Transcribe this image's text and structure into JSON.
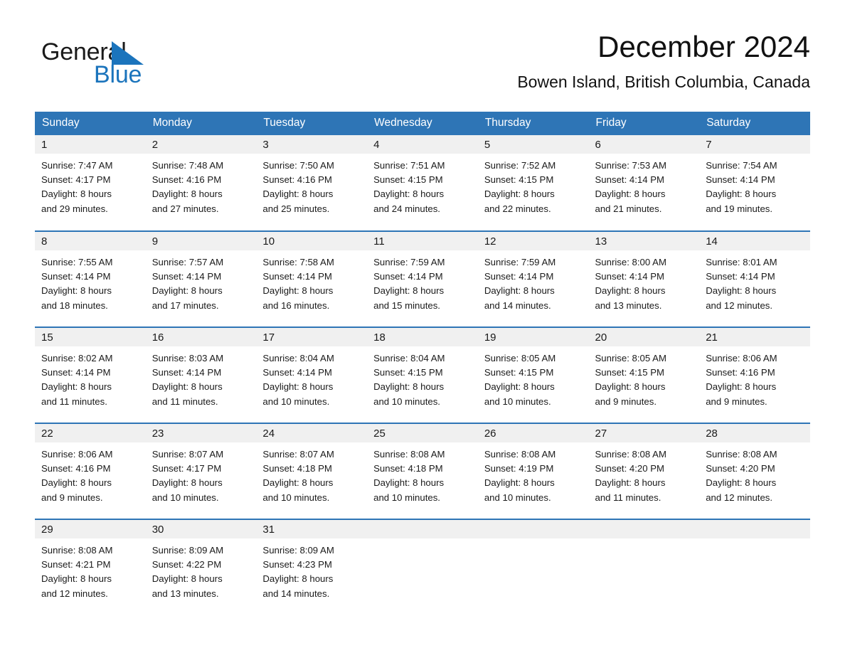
{
  "brand": {
    "name_part1": "General",
    "name_part2": "Blue",
    "triangle_color": "#1b74bc",
    "accent_color": "#2e75b6"
  },
  "header": {
    "title": "December 2024",
    "subtitle": "Bowen Island, British Columbia, Canada"
  },
  "calendar": {
    "weekday_headers": [
      "Sunday",
      "Monday",
      "Tuesday",
      "Wednesday",
      "Thursday",
      "Friday",
      "Saturday"
    ],
    "header_bg": "#2e75b6",
    "daynum_bg": "#f0f0f0",
    "weeks": [
      [
        {
          "day": "1",
          "sunrise": "Sunrise: 7:47 AM",
          "sunset": "Sunset: 4:17 PM",
          "daylight_line1": "Daylight: 8 hours",
          "daylight_line2": "and 29 minutes."
        },
        {
          "day": "2",
          "sunrise": "Sunrise: 7:48 AM",
          "sunset": "Sunset: 4:16 PM",
          "daylight_line1": "Daylight: 8 hours",
          "daylight_line2": "and 27 minutes."
        },
        {
          "day": "3",
          "sunrise": "Sunrise: 7:50 AM",
          "sunset": "Sunset: 4:16 PM",
          "daylight_line1": "Daylight: 8 hours",
          "daylight_line2": "and 25 minutes."
        },
        {
          "day": "4",
          "sunrise": "Sunrise: 7:51 AM",
          "sunset": "Sunset: 4:15 PM",
          "daylight_line1": "Daylight: 8 hours",
          "daylight_line2": "and 24 minutes."
        },
        {
          "day": "5",
          "sunrise": "Sunrise: 7:52 AM",
          "sunset": "Sunset: 4:15 PM",
          "daylight_line1": "Daylight: 8 hours",
          "daylight_line2": "and 22 minutes."
        },
        {
          "day": "6",
          "sunrise": "Sunrise: 7:53 AM",
          "sunset": "Sunset: 4:14 PM",
          "daylight_line1": "Daylight: 8 hours",
          "daylight_line2": "and 21 minutes."
        },
        {
          "day": "7",
          "sunrise": "Sunrise: 7:54 AM",
          "sunset": "Sunset: 4:14 PM",
          "daylight_line1": "Daylight: 8 hours",
          "daylight_line2": "and 19 minutes."
        }
      ],
      [
        {
          "day": "8",
          "sunrise": "Sunrise: 7:55 AM",
          "sunset": "Sunset: 4:14 PM",
          "daylight_line1": "Daylight: 8 hours",
          "daylight_line2": "and 18 minutes."
        },
        {
          "day": "9",
          "sunrise": "Sunrise: 7:57 AM",
          "sunset": "Sunset: 4:14 PM",
          "daylight_line1": "Daylight: 8 hours",
          "daylight_line2": "and 17 minutes."
        },
        {
          "day": "10",
          "sunrise": "Sunrise: 7:58 AM",
          "sunset": "Sunset: 4:14 PM",
          "daylight_line1": "Daylight: 8 hours",
          "daylight_line2": "and 16 minutes."
        },
        {
          "day": "11",
          "sunrise": "Sunrise: 7:59 AM",
          "sunset": "Sunset: 4:14 PM",
          "daylight_line1": "Daylight: 8 hours",
          "daylight_line2": "and 15 minutes."
        },
        {
          "day": "12",
          "sunrise": "Sunrise: 7:59 AM",
          "sunset": "Sunset: 4:14 PM",
          "daylight_line1": "Daylight: 8 hours",
          "daylight_line2": "and 14 minutes."
        },
        {
          "day": "13",
          "sunrise": "Sunrise: 8:00 AM",
          "sunset": "Sunset: 4:14 PM",
          "daylight_line1": "Daylight: 8 hours",
          "daylight_line2": "and 13 minutes."
        },
        {
          "day": "14",
          "sunrise": "Sunrise: 8:01 AM",
          "sunset": "Sunset: 4:14 PM",
          "daylight_line1": "Daylight: 8 hours",
          "daylight_line2": "and 12 minutes."
        }
      ],
      [
        {
          "day": "15",
          "sunrise": "Sunrise: 8:02 AM",
          "sunset": "Sunset: 4:14 PM",
          "daylight_line1": "Daylight: 8 hours",
          "daylight_line2": "and 11 minutes."
        },
        {
          "day": "16",
          "sunrise": "Sunrise: 8:03 AM",
          "sunset": "Sunset: 4:14 PM",
          "daylight_line1": "Daylight: 8 hours",
          "daylight_line2": "and 11 minutes."
        },
        {
          "day": "17",
          "sunrise": "Sunrise: 8:04 AM",
          "sunset": "Sunset: 4:14 PM",
          "daylight_line1": "Daylight: 8 hours",
          "daylight_line2": "and 10 minutes."
        },
        {
          "day": "18",
          "sunrise": "Sunrise: 8:04 AM",
          "sunset": "Sunset: 4:15 PM",
          "daylight_line1": "Daylight: 8 hours",
          "daylight_line2": "and 10 minutes."
        },
        {
          "day": "19",
          "sunrise": "Sunrise: 8:05 AM",
          "sunset": "Sunset: 4:15 PM",
          "daylight_line1": "Daylight: 8 hours",
          "daylight_line2": "and 10 minutes."
        },
        {
          "day": "20",
          "sunrise": "Sunrise: 8:05 AM",
          "sunset": "Sunset: 4:15 PM",
          "daylight_line1": "Daylight: 8 hours",
          "daylight_line2": "and 9 minutes."
        },
        {
          "day": "21",
          "sunrise": "Sunrise: 8:06 AM",
          "sunset": "Sunset: 4:16 PM",
          "daylight_line1": "Daylight: 8 hours",
          "daylight_line2": "and 9 minutes."
        }
      ],
      [
        {
          "day": "22",
          "sunrise": "Sunrise: 8:06 AM",
          "sunset": "Sunset: 4:16 PM",
          "daylight_line1": "Daylight: 8 hours",
          "daylight_line2": "and 9 minutes."
        },
        {
          "day": "23",
          "sunrise": "Sunrise: 8:07 AM",
          "sunset": "Sunset: 4:17 PM",
          "daylight_line1": "Daylight: 8 hours",
          "daylight_line2": "and 10 minutes."
        },
        {
          "day": "24",
          "sunrise": "Sunrise: 8:07 AM",
          "sunset": "Sunset: 4:18 PM",
          "daylight_line1": "Daylight: 8 hours",
          "daylight_line2": "and 10 minutes."
        },
        {
          "day": "25",
          "sunrise": "Sunrise: 8:08 AM",
          "sunset": "Sunset: 4:18 PM",
          "daylight_line1": "Daylight: 8 hours",
          "daylight_line2": "and 10 minutes."
        },
        {
          "day": "26",
          "sunrise": "Sunrise: 8:08 AM",
          "sunset": "Sunset: 4:19 PM",
          "daylight_line1": "Daylight: 8 hours",
          "daylight_line2": "and 10 minutes."
        },
        {
          "day": "27",
          "sunrise": "Sunrise: 8:08 AM",
          "sunset": "Sunset: 4:20 PM",
          "daylight_line1": "Daylight: 8 hours",
          "daylight_line2": "and 11 minutes."
        },
        {
          "day": "28",
          "sunrise": "Sunrise: 8:08 AM",
          "sunset": "Sunset: 4:20 PM",
          "daylight_line1": "Daylight: 8 hours",
          "daylight_line2": "and 12 minutes."
        }
      ],
      [
        {
          "day": "29",
          "sunrise": "Sunrise: 8:08 AM",
          "sunset": "Sunset: 4:21 PM",
          "daylight_line1": "Daylight: 8 hours",
          "daylight_line2": "and 12 minutes."
        },
        {
          "day": "30",
          "sunrise": "Sunrise: 8:09 AM",
          "sunset": "Sunset: 4:22 PM",
          "daylight_line1": "Daylight: 8 hours",
          "daylight_line2": "and 13 minutes."
        },
        {
          "day": "31",
          "sunrise": "Sunrise: 8:09 AM",
          "sunset": "Sunset: 4:23 PM",
          "daylight_line1": "Daylight: 8 hours",
          "daylight_line2": "and 14 minutes."
        },
        {
          "day": "",
          "sunrise": "",
          "sunset": "",
          "daylight_line1": "",
          "daylight_line2": ""
        },
        {
          "day": "",
          "sunrise": "",
          "sunset": "",
          "daylight_line1": "",
          "daylight_line2": ""
        },
        {
          "day": "",
          "sunrise": "",
          "sunset": "",
          "daylight_line1": "",
          "daylight_line2": ""
        },
        {
          "day": "",
          "sunrise": "",
          "sunset": "",
          "daylight_line1": "",
          "daylight_line2": ""
        }
      ]
    ]
  }
}
